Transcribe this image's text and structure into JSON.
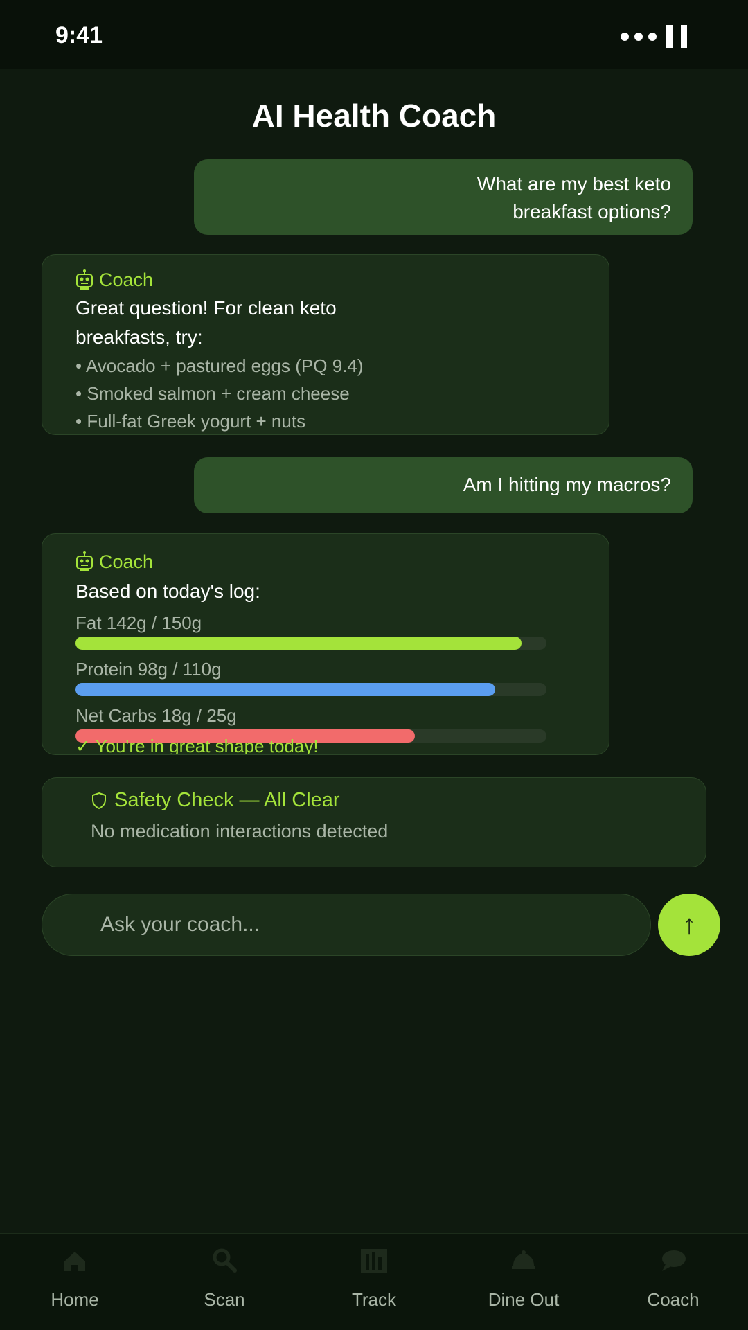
{
  "status": {
    "time": "9:41"
  },
  "header": {
    "title": "AI Health Coach"
  },
  "messages": {
    "user1": {
      "line1": "What are my best keto",
      "line2": "breakfast options?"
    },
    "coach1": {
      "sender": "Coach",
      "lead_line1": "Great question! For clean keto",
      "lead_line2": "breakfasts, try:",
      "items": [
        "• Avocado + pastured eggs (PQ 9.4)",
        "• Smoked salmon + cream cheese",
        "• Full-fat Greek yogurt + nuts"
      ]
    },
    "user2": {
      "text": "Am I hitting my macros?"
    },
    "coach2": {
      "sender": "Coach",
      "lead": "Based on today's log:",
      "macros": [
        {
          "label": "Fat 142g / 150g",
          "value": 142,
          "goal": 150,
          "color": "#a4e33a"
        },
        {
          "label": "Protein 98g / 110g",
          "value": 98,
          "goal": 110,
          "color": "#5b9ef0"
        },
        {
          "label": "Net Carbs 18g / 25g",
          "value": 18,
          "goal": 25,
          "color": "#f26b6b"
        }
      ],
      "note": "✓ You're in great shape today!"
    }
  },
  "safety": {
    "icon": "shield-icon",
    "title": "Safety Check — All Clear",
    "subtitle": "No medication interactions detected"
  },
  "input": {
    "placeholder": "Ask your coach..."
  },
  "send": {
    "label": "↑"
  },
  "nav": {
    "items": [
      {
        "label": "Home",
        "icon": "home-icon"
      },
      {
        "label": "Scan",
        "icon": "search-icon"
      },
      {
        "label": "Track",
        "icon": "chart-icon"
      },
      {
        "label": "Dine Out",
        "icon": "dining-icon"
      },
      {
        "label": "Coach",
        "icon": "chat-icon"
      }
    ]
  },
  "colors": {
    "accent": "#a4e33a",
    "background": "#0f1a0f",
    "card": "#1b2e19",
    "user_bubble": "#2e5229"
  }
}
